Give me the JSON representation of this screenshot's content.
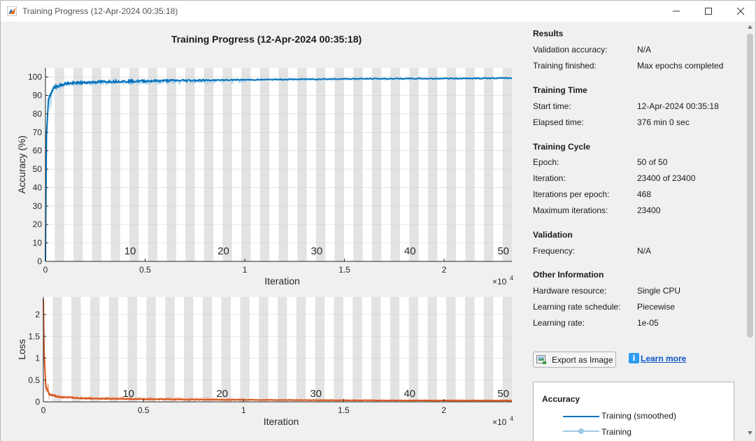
{
  "window": {
    "title": "Training Progress (12-Apr-2024 00:35:18)"
  },
  "plot": {
    "title": "Training Progress (12-Apr-2024 00:35:18)",
    "exponent_label": "×10",
    "exponent_power": "4"
  },
  "panel": {
    "results": {
      "heading": "Results",
      "rows": [
        {
          "label": "Validation accuracy:",
          "value": "N/A"
        },
        {
          "label": "Training finished:",
          "value": "Max epochs completed"
        }
      ]
    },
    "time": {
      "heading": "Training Time",
      "rows": [
        {
          "label": "Start time:",
          "value": "12-Apr-2024 00:35:18"
        },
        {
          "label": "Elapsed time:",
          "value": "376 min 0 sec"
        }
      ]
    },
    "cycle": {
      "heading": "Training Cycle",
      "rows": [
        {
          "label": "Epoch:",
          "value": "50 of 50"
        },
        {
          "label": "Iteration:",
          "value": "23400 of 23400"
        },
        {
          "label": "Iterations per epoch:",
          "value": "468"
        },
        {
          "label": "Maximum iterations:",
          "value": "23400"
        }
      ]
    },
    "validation": {
      "heading": "Validation",
      "rows": [
        {
          "label": "Frequency:",
          "value": "N/A"
        }
      ]
    },
    "other": {
      "heading": "Other Information",
      "rows": [
        {
          "label": "Hardware resource:",
          "value": "Single CPU"
        },
        {
          "label": "Learning rate schedule:",
          "value": "Piecewise"
        },
        {
          "label": "Learning rate:",
          "value": "1e-05"
        }
      ]
    }
  },
  "buttons": {
    "export": "Export as Image",
    "learn_more": "Learn more"
  },
  "legend": {
    "heading": "Accuracy",
    "smoothed": "Training (smoothed)",
    "raw": "Training"
  },
  "colors": {
    "accuracy_line": "#0072bd",
    "accuracy_raw": "#9ecae8",
    "loss_line": "#d95319",
    "loss_raw": "#f0a888",
    "epoch_stripe": "#e3e3e3"
  },
  "chart_data": [
    {
      "type": "line",
      "ylabel": "Accuracy (%)",
      "xlabel": "Iteration",
      "xlim": [
        0,
        23400
      ],
      "ylim": [
        0,
        105
      ],
      "xticks": [
        0,
        5000,
        10000,
        15000,
        20000
      ],
      "xtick_labels": [
        "0",
        "0.5",
        "1",
        "1.5",
        "2"
      ],
      "yticks": [
        0,
        10,
        20,
        30,
        40,
        50,
        60,
        70,
        80,
        90,
        100
      ],
      "epoch_labels": [
        "10",
        "20",
        "30",
        "40",
        "50"
      ],
      "series": [
        {
          "name": "Training (smoothed)",
          "x": [
            0,
            50,
            150,
            400,
            1000,
            3000,
            6000,
            10000,
            15000,
            20000,
            23400
          ],
          "values": [
            0,
            68,
            88,
            94,
            96.5,
            97.5,
            98,
            98.5,
            99,
            99.2,
            99.4
          ]
        }
      ]
    },
    {
      "type": "line",
      "ylabel": "Loss",
      "xlabel": "Iteration",
      "xlim": [
        0,
        23400
      ],
      "ylim": [
        0,
        2.4
      ],
      "xticks": [
        0,
        5000,
        10000,
        15000,
        20000
      ],
      "xtick_labels": [
        "0",
        "0.5",
        "1",
        "1.5",
        "2"
      ],
      "yticks": [
        0,
        0.5,
        1,
        1.5,
        2
      ],
      "ytick_labels": [
        "0",
        "0.5",
        "1",
        "1.5",
        "2"
      ],
      "epoch_labels": [
        "10",
        "20",
        "30",
        "40",
        "50"
      ],
      "series": [
        {
          "name": "Training (smoothed)",
          "x": [
            0,
            40,
            120,
            300,
            800,
            2000,
            5000,
            10000,
            15000,
            20000,
            23400
          ],
          "values": [
            2.35,
            1.1,
            0.35,
            0.17,
            0.11,
            0.08,
            0.06,
            0.045,
            0.035,
            0.03,
            0.028
          ]
        }
      ]
    }
  ]
}
